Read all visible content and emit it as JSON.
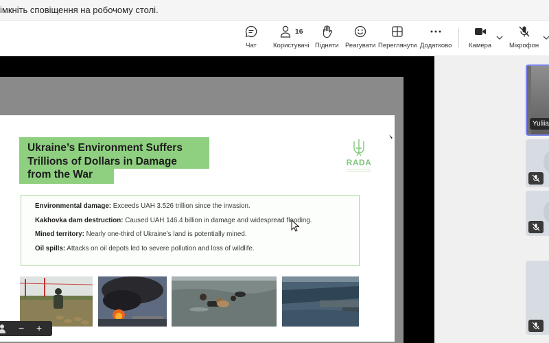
{
  "notification": {
    "text": "імкніть сповіщення на робочому столі."
  },
  "toolbar": {
    "chat_label": "Чат",
    "users_label": "Користувачі",
    "users_count": "16",
    "raise_label": "Підняти",
    "react_label": "Реагувати",
    "view_label": "Переглянути",
    "more_label": "Додатково",
    "camera_label": "Камера",
    "mic_label": "Мікрофон"
  },
  "slide": {
    "title_line1": "Ukraine’s Environment Suffers",
    "title_line2": "Trillions of Dollars in Damage",
    "title_line3": "from the War",
    "logo_text": "RADA",
    "items": [
      {
        "bold": "Environmental damage:",
        "text": " Exceeds UAH 3.526 trillion since the invasion."
      },
      {
        "bold": "Kakhovka dam destruction:",
        "text": " Caused UAH 146.4 billion in damage and widespread flooding."
      },
      {
        "bold": "Mined territory:",
        "text": " Nearly one-third of Ukraine’s land is potentially mined."
      },
      {
        "bold": "Oil spills:",
        "text": " Attacks on oil depots led to severe pollution and loss of wildlife."
      }
    ]
  },
  "zoom": {
    "minus": "−",
    "plus": "+"
  },
  "participants": [
    {
      "name": "Yuliia"
    }
  ],
  "colors": {
    "title_bg": "#8fd080",
    "box_border": "#a6d89b",
    "logo": "#7fc77a",
    "active_tile": "#7b83eb"
  }
}
